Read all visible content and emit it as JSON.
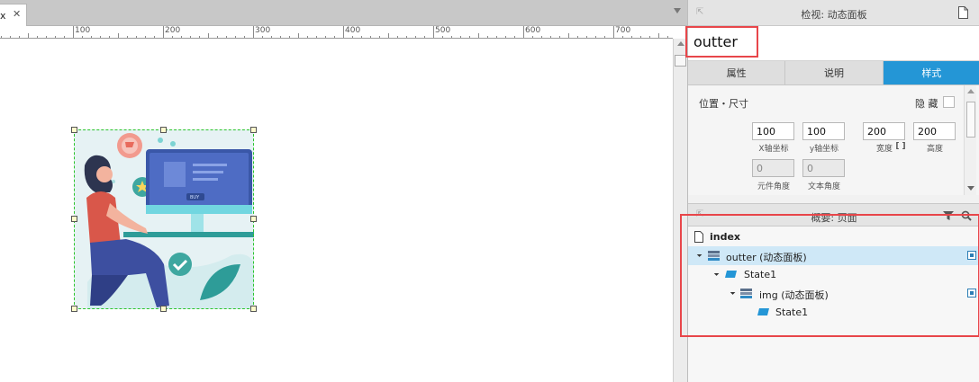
{
  "document_tab": {
    "label": "x",
    "close": "✕"
  },
  "ruler": {
    "labels": [
      "100",
      "200",
      "300",
      "400",
      "500",
      "600",
      "700"
    ]
  },
  "widget": {
    "name": "outter"
  },
  "inspector": {
    "title": "检视: 动态面板",
    "name_value": "outter",
    "tabs": [
      "属性",
      "说明",
      "样式"
    ],
    "active_tab": "样式",
    "section_title": "位置・尺寸",
    "hide_label": "隐 藏",
    "fields": {
      "x": {
        "value": "100",
        "caption": "X轴坐标"
      },
      "y": {
        "value": "100",
        "caption": "y轴坐标"
      },
      "w": {
        "value": "200",
        "caption": "宽度"
      },
      "h": {
        "value": "200",
        "caption": "高度"
      },
      "lock": "[ ]",
      "rotation": {
        "value": "0",
        "caption": "元件角度"
      },
      "text_rotation": {
        "value": "0",
        "caption": "文本角度"
      }
    }
  },
  "outline": {
    "title": "概要: 页面",
    "items": [
      {
        "label": "index"
      },
      {
        "label": "outter (动态面板)"
      },
      {
        "label": "State1"
      },
      {
        "label": "img (动态面板)"
      },
      {
        "label": "State1"
      }
    ]
  },
  "colors": {
    "accent": "#2496d6",
    "highlight": "#e8464a",
    "selection": "#2bc52b"
  }
}
